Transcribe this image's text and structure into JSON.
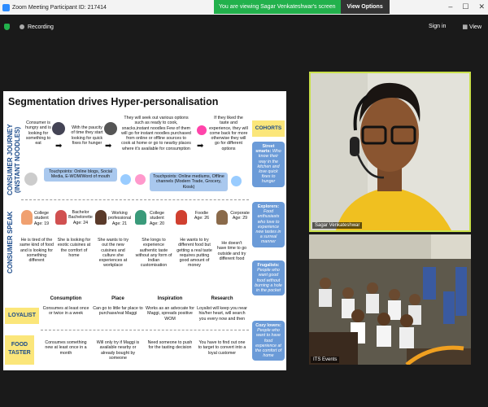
{
  "titlebar": {
    "title": "Zoom Meeting Participant ID: 217414"
  },
  "banner": {
    "message": "You are viewing Sagar Venkateshwar's screen",
    "view_options": "View Options"
  },
  "toolbar": {
    "recording": "Recording",
    "sign_in": "Sign in",
    "view": "View"
  },
  "slide": {
    "title": "Segmentation drives Hyper-personalisation",
    "side_journey": "CONSUMER JOURNEY (INSTANT NOODLES)",
    "side_speak": "CONSUMER SPEAK",
    "journey": [
      "Consumer is hungry and is looking for something to eat",
      "With the paucity of time they start looking for quick fixes for hunger",
      "They will seek out various options such as ready to cook, snacks,instant noodles Few of them will go for instant noodles purchased from online or offline sources to cook at home or go to nearby places where it's available for consumption",
      "If they liked the taste and experience, they will come back for more otherwise they will go for different options"
    ],
    "touchpoints1": "Touchpoints: Online blogs, Social Media, E-WOM/Word of mouth",
    "touchpoints2": "Touchpoints: Online mediums, Offline channels (Modern Trade, Grocery, Kiosk)",
    "personas": [
      {
        "label": "College student Age: 19",
        "quote": "He is tired of the same kind of food and is looking for something different"
      },
      {
        "label": "Bachelor Bachelorette Age: 24",
        "quote": "She is looking for exotic cuisines at the comfort of home"
      },
      {
        "label": "Working professional Age: 21",
        "quote": "She wants to try out the new cuisines and culture she experiences at workplace"
      },
      {
        "label": "College student Age: 20",
        "quote": "She longs to experience authentic taste without any form of Indian customisation"
      },
      {
        "label": "Foodie Age: 26",
        "quote": "He wants to try different food but getting a real taste requires putting good amount of money"
      },
      {
        "label": "Corporate Age: 29",
        "quote": "He doesn't have time to go outside and try different food"
      }
    ],
    "table_headers": [
      "Consumption",
      "Place",
      "Inspiration",
      "Research"
    ],
    "rows": [
      {
        "label": "LOYALIST",
        "cells": [
          "Consumes at least once or twice in a week",
          "Can go to little far place to purchase/eat Maggi",
          "Works as an advocate for Maggi, spreads positive WOM",
          "Loyalist will keep you near his/her heart, will search you every now and then"
        ]
      },
      {
        "label": "FOOD TASTER",
        "cells": [
          "Consumes something new at least once in a month",
          "Will only try if Maggi is available nearby or already bought by someone",
          "Need someone to push for the tasting decision",
          "You have to find out one to target to convert into a loyal customer"
        ]
      }
    ],
    "cohorts_title": "COHORTS",
    "cohorts": [
      {
        "name": "Street smarts:",
        "desc": "Who know their way in the kitchen and love quick fixes to hunger"
      },
      {
        "name": "Explorers:",
        "desc": "Food enthusiasts who love to experience new tastes in a surreal manner"
      },
      {
        "name": "Frugalists:",
        "desc": "People who want good food without burning a hole in the pocket"
      },
      {
        "name": "Cozy lovers:",
        "desc": "People who want to have food experience at the comfort of home"
      }
    ]
  },
  "videos": [
    {
      "name": "Sagar Venkateshwar"
    },
    {
      "name": "ITS Events"
    }
  ]
}
